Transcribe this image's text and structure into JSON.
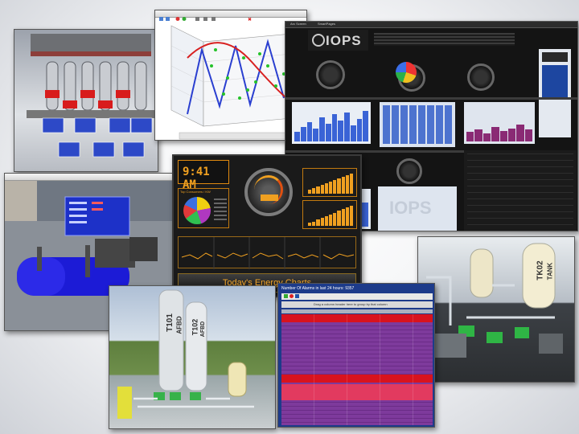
{
  "iops": {
    "logo": "IOPS",
    "header_left": "Arc Screen",
    "header_tab": "SmartPages"
  },
  "energy": {
    "time": "9:41 AM",
    "pie_title": "Top Consumers / KW",
    "footer_title": "Today's Energy Charts"
  },
  "alarms": {
    "title": "Number Of Alarms in last 24 hours: 9357",
    "banner": "Drag a column header here to group by that column"
  },
  "plant": {
    "tank_label": "TK02",
    "tank_sub": "TANK"
  },
  "silos": {
    "silo1_label": "T101",
    "silo1_sub": "AFBD",
    "silo2_label": "T102",
    "silo2_sub": "AFBD"
  },
  "colors": {
    "alarm_red": "#d8131e",
    "alarm_purple": "#7e3a9c",
    "energy_orange": "#f0a020",
    "chart_blue": "#3a63d6"
  }
}
